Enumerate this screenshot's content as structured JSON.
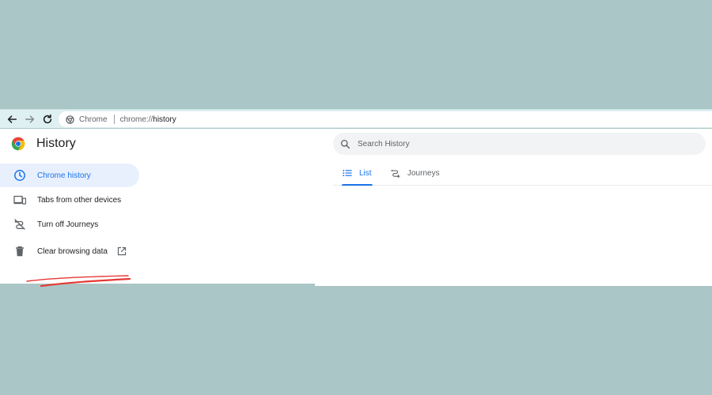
{
  "toolbar": {
    "omnibox_site": "Chrome",
    "omnibox_url_scheme": "chrome://",
    "omnibox_url_path": "history"
  },
  "page": {
    "title": "History"
  },
  "sidebar": {
    "items": [
      {
        "label": "Chrome history",
        "icon": "clock-icon",
        "active": true
      },
      {
        "label": "Tabs from other devices",
        "icon": "devices-icon",
        "active": false
      },
      {
        "label": "Turn off Journeys",
        "icon": "journeys-off-icon",
        "active": false
      },
      {
        "label": "Clear browsing data",
        "icon": "trash-icon",
        "active": false
      }
    ]
  },
  "search": {
    "placeholder": "Search History"
  },
  "tabs": [
    {
      "label": "List",
      "icon": "list-icon",
      "active": true
    },
    {
      "label": "Journeys",
      "icon": "journeys-icon",
      "active": false
    }
  ],
  "colors": {
    "accent": "#1a73e8",
    "background": "#abc6c6",
    "active_item_bg": "#e8f0fe",
    "annotation": "#e53935"
  }
}
